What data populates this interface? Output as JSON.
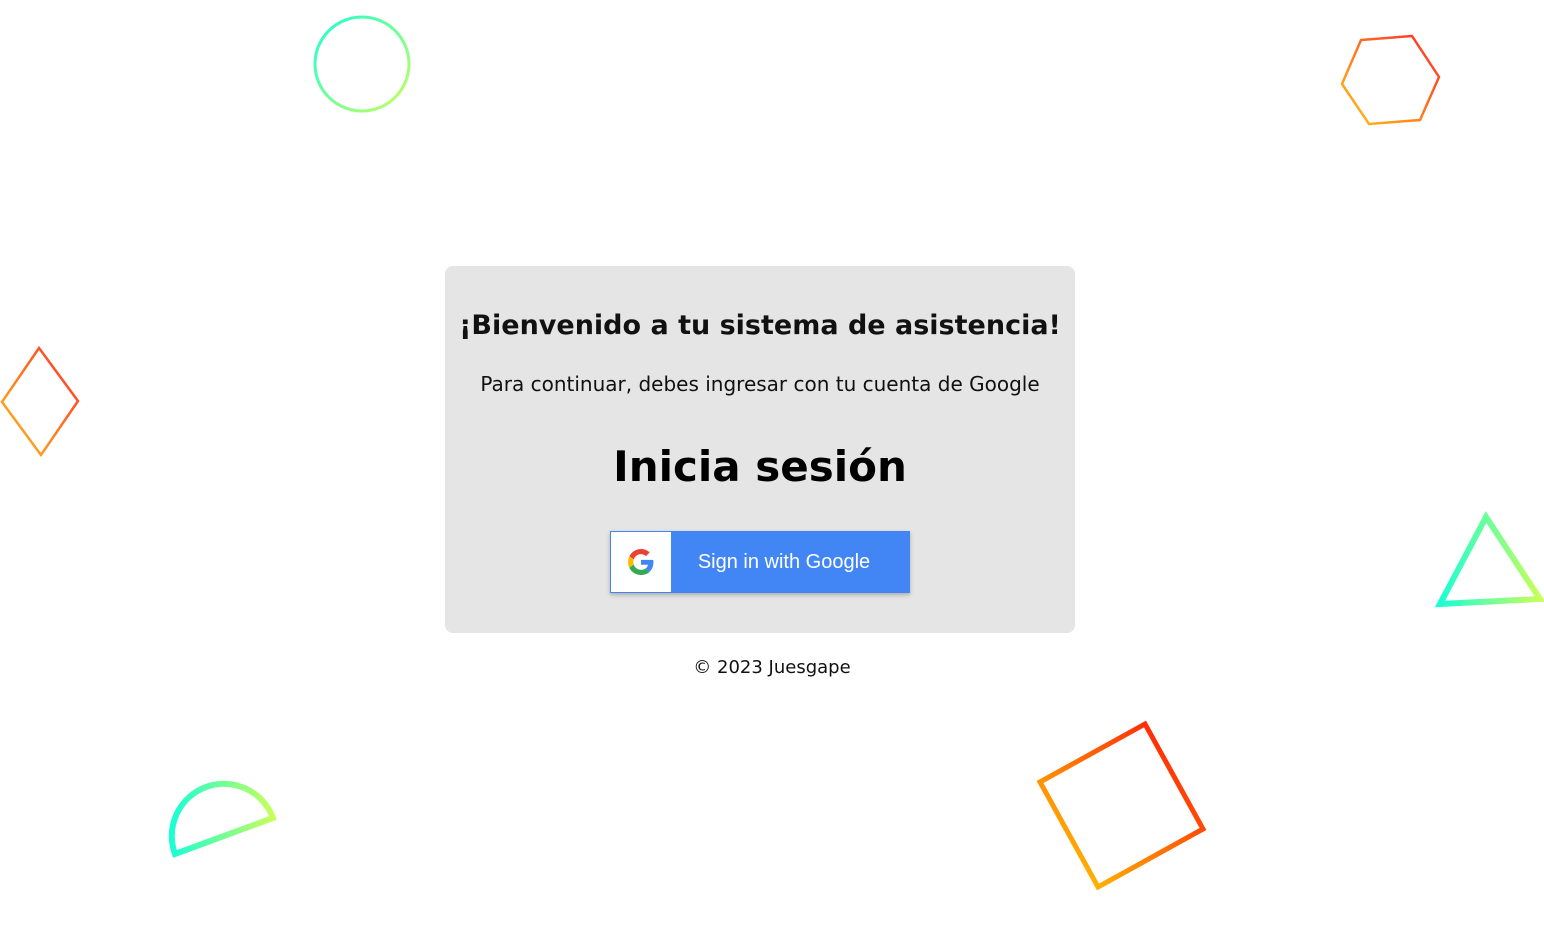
{
  "card": {
    "welcome": "¡Bienvenido a tu sistema de asistencia!",
    "subtitle": "Para continuar, debes ingresar con tu cuenta de Google",
    "login_title": "Inicia sesión",
    "google_button": {
      "label": "Sign in with Google",
      "icon": "google-g-icon",
      "color": "#4285f4"
    }
  },
  "footer": {
    "copyright": "© 2023 Juesgape"
  },
  "colors": {
    "background": "#ffffff",
    "card": "#e5e5e5",
    "google_blue": "#4285f4"
  }
}
